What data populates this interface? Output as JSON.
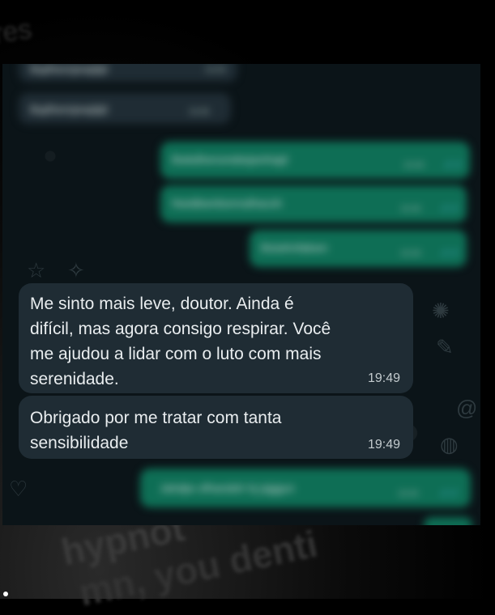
{
  "background": {
    "watermark_lines": [
      "hypnot",
      "mn, you denti"
    ],
    "corner_text": "res"
  },
  "messages": [
    {
      "direction": "in",
      "blurred": true,
      "text": "Bqdhenrjewjdjd",
      "time": "19:48"
    },
    {
      "direction": "in",
      "blurred": true,
      "text": "Bqdhenrjewjdjd",
      "time": "19:48"
    },
    {
      "direction": "out",
      "blurred": true,
      "text": "Bwkdhenorwbejwnhajd",
      "time": "19:48"
    },
    {
      "direction": "out",
      "blurred": true,
      "text": "Nwidbwnbsnrsdhacsh",
      "time": "19:48"
    },
    {
      "direction": "out",
      "blurred": true,
      "text": "Bsiwhnfabwn",
      "time": "19:48"
    },
    {
      "direction": "in",
      "blurred": false,
      "text": "Me sinto mais leve, doutor. Ainda é\ndifícil, mas agora consigo respirar. Você\nme ajudou a lidar com o luto com mais\nserenidade.",
      "time": "19:49"
    },
    {
      "direction": "in",
      "blurred": false,
      "text": "Obrigado por me tratar com tanta\nsensibilidade",
      "time": "19:49"
    },
    {
      "direction": "out",
      "blurred": true,
      "text": "Jahdjw ofhandsh hj jsjjgjun",
      "time": "19:49"
    }
  ],
  "colors": {
    "incoming_bubble": "#1f2c34",
    "outgoing_bubble": "#0e6e55",
    "chat_background": "#0b1418",
    "read_tick": "#53bdeb"
  }
}
